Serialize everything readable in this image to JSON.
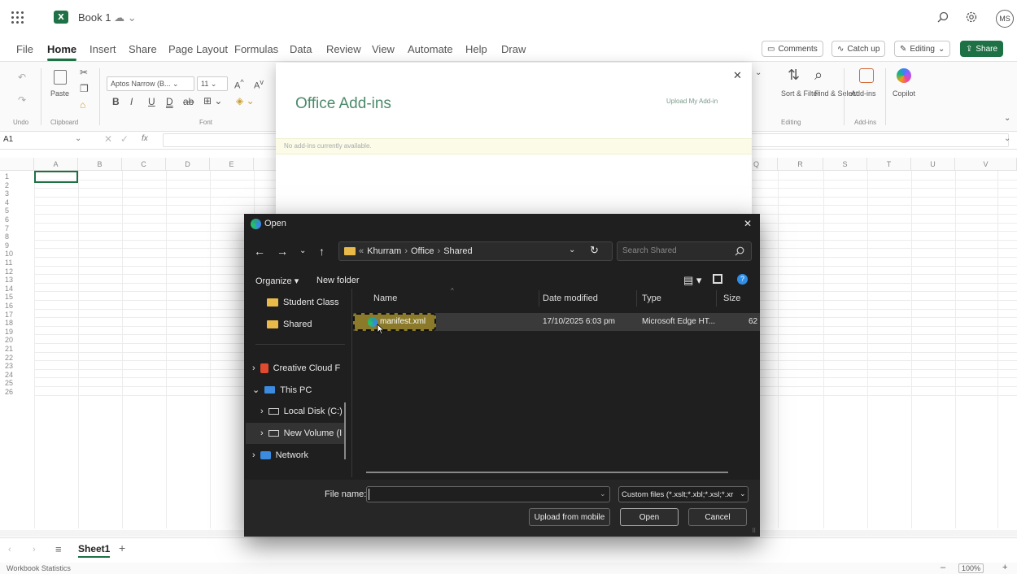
{
  "titlebar": {
    "book": "Book 1",
    "avatar": "MS",
    "logo": "X"
  },
  "menu": {
    "tabs": [
      "File",
      "Home",
      "Insert",
      "Share",
      "Page Layout",
      "Formulas",
      "Data",
      "Review",
      "View",
      "Automate",
      "Help",
      "Draw"
    ],
    "comments": "Comments",
    "catchup": "Catch up",
    "editing": "Editing",
    "share": "Share"
  },
  "ribbon": {
    "undo": "Undo",
    "clipboard": "Clipboard",
    "paste": "Paste",
    "font_name": "Aptos Narrow (B...",
    "font_size": "11",
    "font": "Font",
    "sort_filter": "Sort & Filter",
    "find_select": "Find & Select",
    "editing": "Editing",
    "addins": "Add-ins",
    "addins_group": "Add-ins",
    "copilot": "Copilot"
  },
  "formula": {
    "cellref": "A1",
    "fx": "fx"
  },
  "grid": {
    "left_cols": [
      "A",
      "B",
      "C",
      "D",
      "E"
    ],
    "right_cols": [
      "Q",
      "R",
      "S",
      "T",
      "U",
      "V"
    ],
    "rows": [
      "1",
      "2",
      "3",
      "4",
      "5",
      "6",
      "7",
      "8",
      "9",
      "10",
      "11",
      "12",
      "13",
      "14",
      "15",
      "16",
      "17",
      "18",
      "19",
      "20",
      "21",
      "22",
      "23",
      "24",
      "25",
      "26"
    ]
  },
  "sheets": {
    "active": "Sheet1",
    "add": "+"
  },
  "status": {
    "left": "Workbook Statistics",
    "zoom": "100%"
  },
  "addins_dialog": {
    "title": "Office Add-ins",
    "upload": "Upload My Add-in",
    "empty": "No add-ins currently available."
  },
  "open_dialog": {
    "title": "Open",
    "path": [
      "Khurram",
      "Office",
      "Shared"
    ],
    "search_placeholder": "Search Shared",
    "organize": "Organize",
    "new_folder": "New folder",
    "nav": [
      "Student Class",
      "Shared",
      "Creative Cloud F",
      "This PC",
      "Local Disk (C:)",
      "New Volume (I",
      "Network"
    ],
    "columns": [
      "Name",
      "Date modified",
      "Type",
      "Size"
    ],
    "file": {
      "name": "manifest.xml",
      "date": "17/10/2025 6:03 pm",
      "type": "Microsoft Edge HT...",
      "size": "62"
    },
    "file_name_label": "File name:",
    "file_name_value": "",
    "filter": "Custom files (*.xslt;*.xbl;*.xsl;*.xr",
    "upload_mobile": "Upload from mobile",
    "open": "Open",
    "cancel": "Cancel"
  },
  "colors": {
    "excel_green": "#1e7145",
    "dialog_dark": "#1f1f1f",
    "highlight": "#8a7a2a"
  }
}
